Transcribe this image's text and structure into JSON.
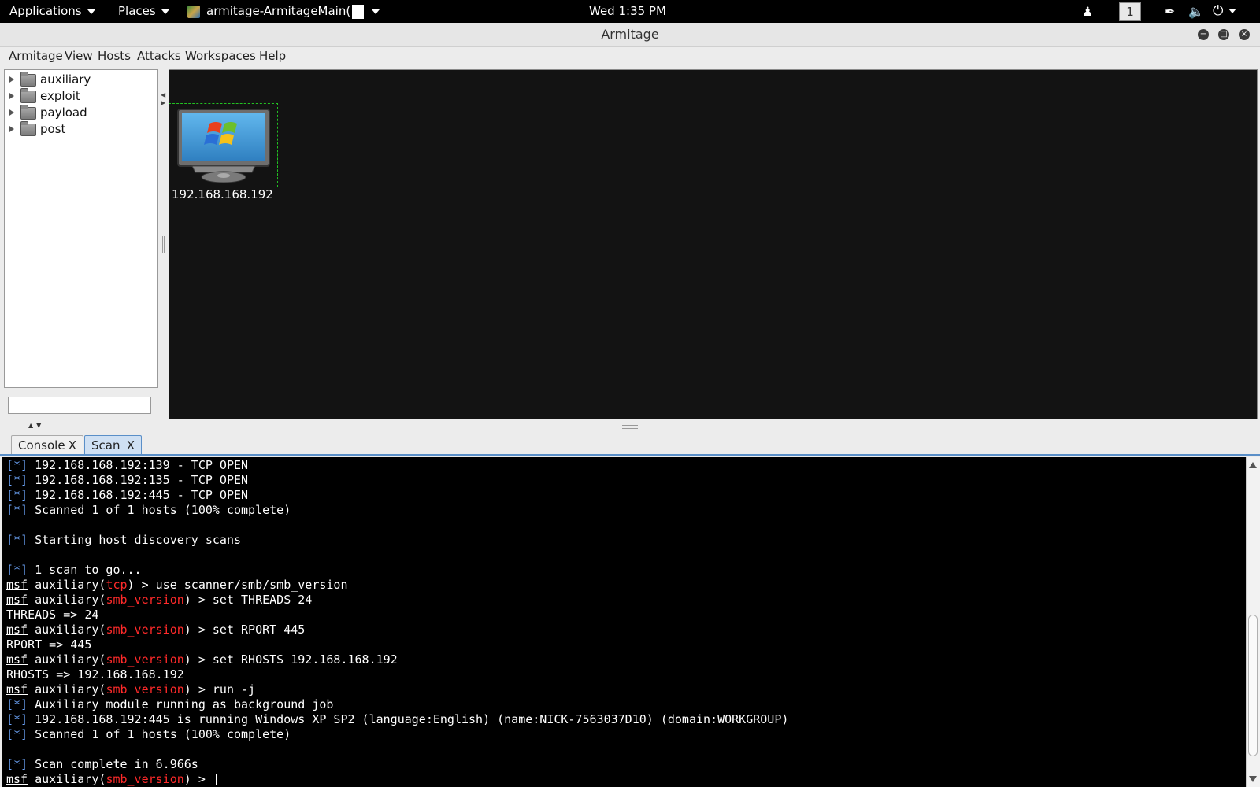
{
  "topbar": {
    "applications": "Applications",
    "places": "Places",
    "window_title": "armitage-ArmitageMain(",
    "clock": "Wed  1:35 PM",
    "workspace": "1"
  },
  "window": {
    "title": "Armitage"
  },
  "menubar": [
    "Armitage",
    "View",
    "Hosts",
    "Attacks",
    "Workspaces",
    "Help"
  ],
  "tree": [
    "auxiliary",
    "exploit",
    "payload",
    "post"
  ],
  "host": {
    "ip": "192.168.168.192",
    "os": "windows-xp-icon"
  },
  "tabs": [
    {
      "label": "Console",
      "close": "X"
    },
    {
      "label": "Scan",
      "close": "X"
    }
  ],
  "console": {
    "bracket": "[*]",
    "prompt_msf": "msf",
    "prompt_aux": " auxiliary(",
    "prompt_close": ") > ",
    "lines": [
      {
        "kind": "info",
        "text": " 192.168.168.192:139 - TCP OPEN"
      },
      {
        "kind": "info",
        "text": " 192.168.168.192:135 - TCP OPEN"
      },
      {
        "kind": "info",
        "text": " 192.168.168.192:445 - TCP OPEN"
      },
      {
        "kind": "info",
        "text": " Scanned 1 of 1 hosts (100% complete)"
      },
      {
        "kind": "blank",
        "text": ""
      },
      {
        "kind": "info",
        "text": " Starting host discovery scans"
      },
      {
        "kind": "blank",
        "text": ""
      },
      {
        "kind": "info",
        "text": " 1 scan to go..."
      },
      {
        "kind": "prompt",
        "module": "tcp",
        "text": "use scanner/smb/smb_version"
      },
      {
        "kind": "prompt",
        "module": "smb_version",
        "text": "set THREADS 24"
      },
      {
        "kind": "plain",
        "text": "THREADS => 24"
      },
      {
        "kind": "prompt",
        "module": "smb_version",
        "text": "set RPORT 445"
      },
      {
        "kind": "plain",
        "text": "RPORT => 445"
      },
      {
        "kind": "prompt",
        "module": "smb_version",
        "text": "set RHOSTS 192.168.168.192"
      },
      {
        "kind": "plain",
        "text": "RHOSTS => 192.168.168.192"
      },
      {
        "kind": "prompt",
        "module": "smb_version",
        "text": "run -j"
      },
      {
        "kind": "info",
        "text": " Auxiliary module running as background job"
      },
      {
        "kind": "info",
        "text": " 192.168.168.192:445 is running Windows XP SP2 (language:English) (name:NICK-7563037D10) (domain:WORKGROUP)"
      },
      {
        "kind": "info",
        "text": " Scanned 1 of 1 hosts (100% complete)"
      },
      {
        "kind": "blank",
        "text": ""
      },
      {
        "kind": "info",
        "text": " Scan complete in 6.966s"
      },
      {
        "kind": "prompt",
        "module": "smb_version",
        "text": ""
      }
    ]
  }
}
